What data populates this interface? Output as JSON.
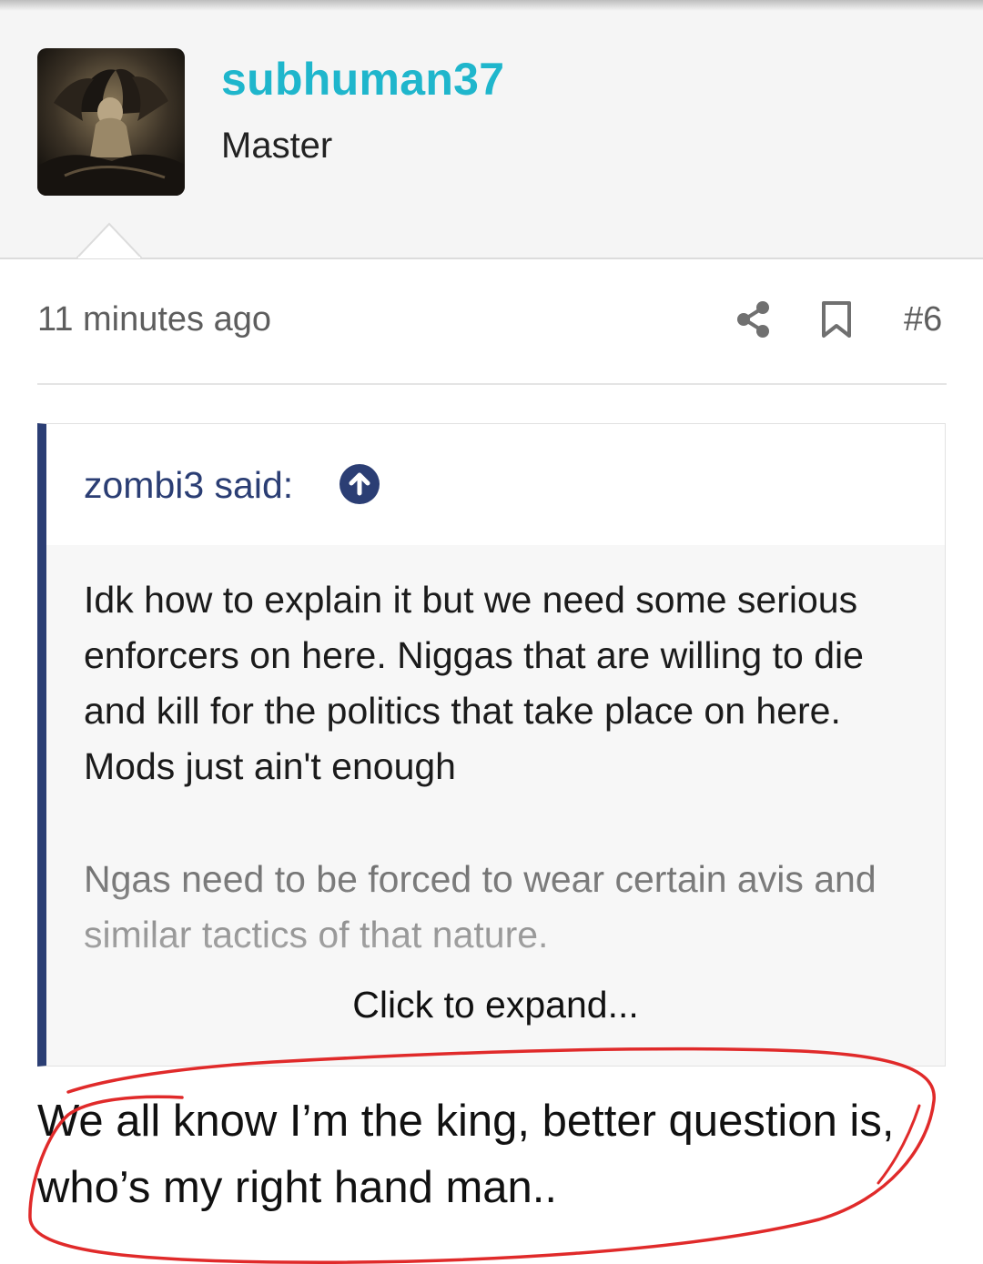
{
  "user": {
    "name": "subhuman37",
    "title": "Master",
    "avatar_icon": "dark-angel-avatar"
  },
  "post": {
    "timestamp": "11 minutes ago",
    "number": "#6",
    "share_icon": "share-icon",
    "bookmark_icon": "bookmark-icon"
  },
  "quote": {
    "author": "zombi3 said:",
    "jump_icon": "arrow-up-circle-icon",
    "paragraph1": "Idk how to explain it but we need some serious enforcers on here. Niggas that are willing to die and kill for the politics that take place on here. Mods just ain't enough",
    "paragraph2": "Ngas need to be forced to wear certain avis and similar tactics of that nature.",
    "expand_label": "Click to expand..."
  },
  "reply": {
    "text": "We all know I’m the king, better question is, who’s my right hand man.."
  },
  "colors": {
    "username": "#1fb6cc",
    "quote_accent": "#2b3e74",
    "annotation": "#e02a2a"
  }
}
